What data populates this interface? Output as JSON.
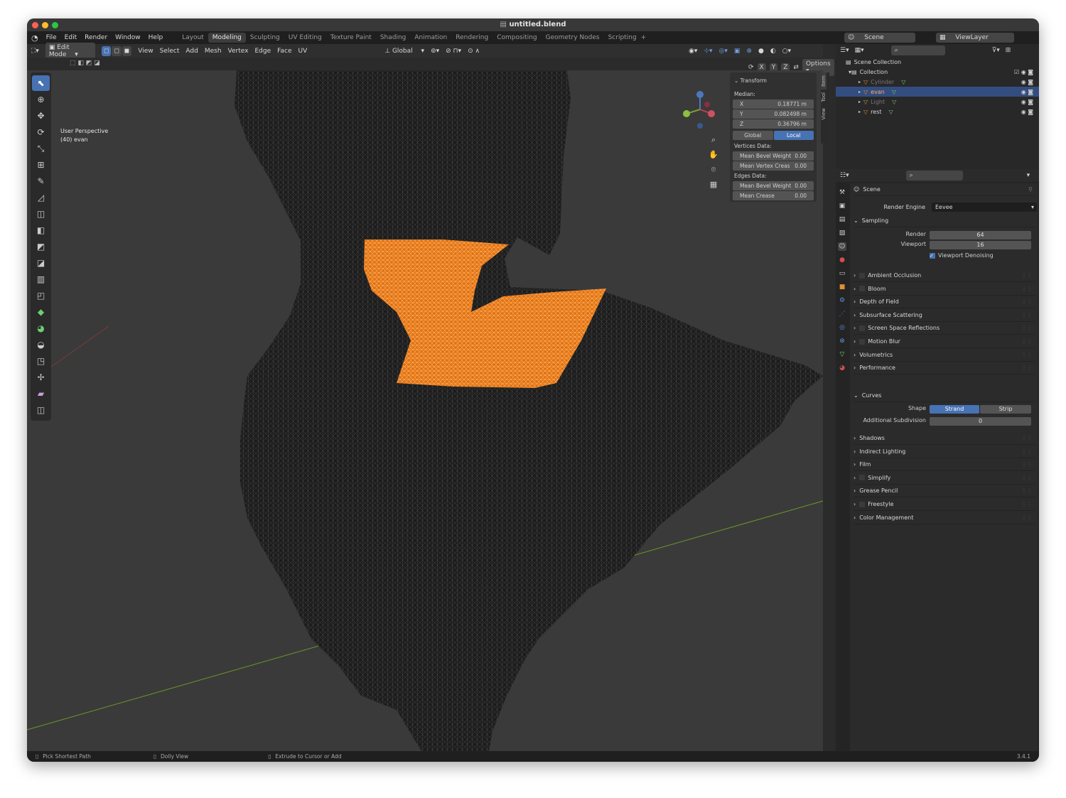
{
  "window": {
    "title": "untitled.blend"
  },
  "menu": [
    "File",
    "Edit",
    "Render",
    "Window",
    "Help"
  ],
  "workspaces": [
    "Layout",
    "Modeling",
    "Sculpting",
    "UV Editing",
    "Texture Paint",
    "Shading",
    "Animation",
    "Rendering",
    "Compositing",
    "Geometry Nodes",
    "Scripting"
  ],
  "active_workspace": "Modeling",
  "scene_selector": "Scene",
  "view_layer": "ViewLayer",
  "viewport_header": {
    "mode": "Edit Mode",
    "menus": [
      "View",
      "Select",
      "Add",
      "Mesh",
      "Vertex",
      "Edge",
      "Face",
      "UV"
    ],
    "orientation": "Global",
    "options": "Options",
    "axes": [
      "X",
      "Y",
      "Z"
    ]
  },
  "viewport": {
    "perspective": "User Perspective",
    "object_info": "(40) evan"
  },
  "n_panel": {
    "tabs": [
      "Item",
      "Tool",
      "View"
    ],
    "transform_label": "Transform",
    "median_label": "Median:",
    "median": [
      {
        "axis": "X",
        "value": "0.18771 m"
      },
      {
        "axis": "Y",
        "value": "0.082498 m"
      },
      {
        "axis": "Z",
        "value": "0.36796 m"
      }
    ],
    "space_global": "Global",
    "space_local": "Local",
    "vertices_label": "Vertices Data:",
    "vertices": [
      {
        "label": "Mean Bevel Weight",
        "value": "0.00"
      },
      {
        "label": "Mean Vertex Creas",
        "value": "0.00"
      }
    ],
    "edges_label": "Edges Data:",
    "edges": [
      {
        "label": "Mean Bevel Weight",
        "value": "0.00"
      },
      {
        "label": "Mean Crease",
        "value": "0.00"
      }
    ]
  },
  "outliner": {
    "root": "Scene Collection",
    "collection": "Collection",
    "items": [
      {
        "name": "Cylinder",
        "dim": true,
        "selected": false,
        "color": "#e08a3c"
      },
      {
        "name": "evan",
        "dim": false,
        "selected": true,
        "color": "#e08a3c"
      },
      {
        "name": "Light",
        "dim": true,
        "selected": false,
        "color": "#c9a35a"
      },
      {
        "name": "rest",
        "dim": false,
        "selected": false,
        "color": "#e08a3c"
      }
    ]
  },
  "properties": {
    "scene_label": "Scene",
    "render_engine_label": "Render Engine",
    "render_engine": "Eevee",
    "sampling": "Sampling",
    "render_label": "Render",
    "render_value": "64",
    "viewport_label": "Viewport",
    "viewport_value": "16",
    "denoise_label": "Viewport Denoising",
    "panels_a": [
      {
        "label": "Ambient Occlusion",
        "check": true
      },
      {
        "label": "Bloom",
        "check": true
      },
      {
        "label": "Depth of Field",
        "check": false
      },
      {
        "label": "Subsurface Scattering",
        "check": false
      },
      {
        "label": "Screen Space Reflections",
        "check": true
      },
      {
        "label": "Motion Blur",
        "check": true
      },
      {
        "label": "Volumetrics",
        "check": false
      },
      {
        "label": "Performance",
        "check": false
      }
    ],
    "curves": "Curves",
    "shape_label": "Shape",
    "shape_strand": "Strand",
    "shape_strip": "Strip",
    "subdiv_label": "Additional Subdivision",
    "subdiv_value": "0",
    "panels_b": [
      {
        "label": "Shadows",
        "check": false
      },
      {
        "label": "Indirect Lighting",
        "check": false
      },
      {
        "label": "Film",
        "check": false
      },
      {
        "label": "Simplify",
        "check": true
      },
      {
        "label": "Grease Pencil",
        "check": false
      },
      {
        "label": "Freestyle",
        "check": true
      },
      {
        "label": "Color Management",
        "check": false
      }
    ]
  },
  "status_bar": {
    "left": "Pick Shortest Path",
    "mid": "Dolly View",
    "right": "Extrude to Cursor or Add",
    "version": "3.4.1"
  },
  "colors": {
    "selection": "#ff8a1a",
    "accent": "#4772b3",
    "mesh": "#1a1a1a"
  }
}
